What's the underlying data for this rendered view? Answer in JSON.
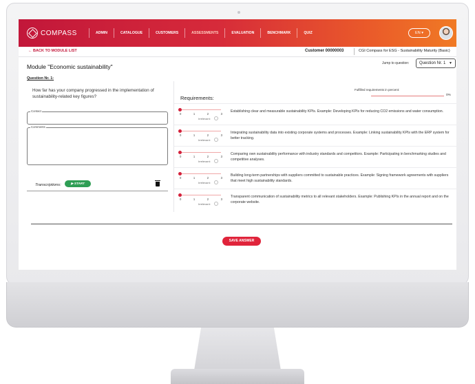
{
  "app": {
    "logo_text": "COMPASS"
  },
  "nav": {
    "items": [
      {
        "label": "ADMIN"
      },
      {
        "label": "CATALOGUE"
      },
      {
        "label": "CUSTOMERS"
      },
      {
        "label": "ASSESSMENTS"
      },
      {
        "label": "EVALUATION"
      },
      {
        "label": "BENCHMARK"
      },
      {
        "label": "QUIZ"
      }
    ],
    "active": "ASSESSMENTS",
    "language": "EN ▾"
  },
  "subheader": {
    "back_label": "← BACK TO MODULE LIST",
    "customer": "Customer 00000003",
    "product": "CGI Compass for ESG - Sustainability Maturity (Basic)"
  },
  "module": {
    "title": "Module \"Economic sustainability\"",
    "jump_label": "Jump to question:",
    "jump_value": "Question Nr. 1",
    "question_number": "Question Nr. 1:",
    "question_text": "How far has your company progressed in the implementation of sustainability-related key figures?"
  },
  "form": {
    "contact_label": "Contact",
    "comments_label": "Comments",
    "transcriptions_label": "Transcriptions:",
    "start_label": "▶ START",
    "save_label": "SAVE ANSWER"
  },
  "requirements": {
    "title": "Requirements:",
    "fulfilled_label": "Fulfilled requirements in percent:",
    "fulfilled_value": "0%",
    "scale": [
      "0",
      "1",
      "2",
      "3"
    ],
    "irrelevant_label": "Irrelevant:",
    "items": [
      {
        "text": "Establishing clear and measurable sustainability KPIs. Example: Developing KPIs for reducing CO2 emissions and water consumption."
      },
      {
        "text": "Integrating sustainability data into existing corporate systems and processes. Example: Linking sustainability KPIs with the ERP system for better tracking."
      },
      {
        "text": "Comparing own sustainability performance with industry standards and competitors. Example: Participating in benchmarking studies and competitive analyses."
      },
      {
        "text": "Building long-term partnerships with suppliers committed to sustainable practices. Example: Signing framework agreements with suppliers that meet high sustainability standards."
      },
      {
        "text": "Transparent communication of sustainability metrics to all relevant stakeholders. Example: Publishing KPIs in the annual report and on the corporate website."
      }
    ]
  },
  "colors": {
    "brand": "#c2173a",
    "accent": "#f07a24",
    "start": "#2f9e55"
  }
}
